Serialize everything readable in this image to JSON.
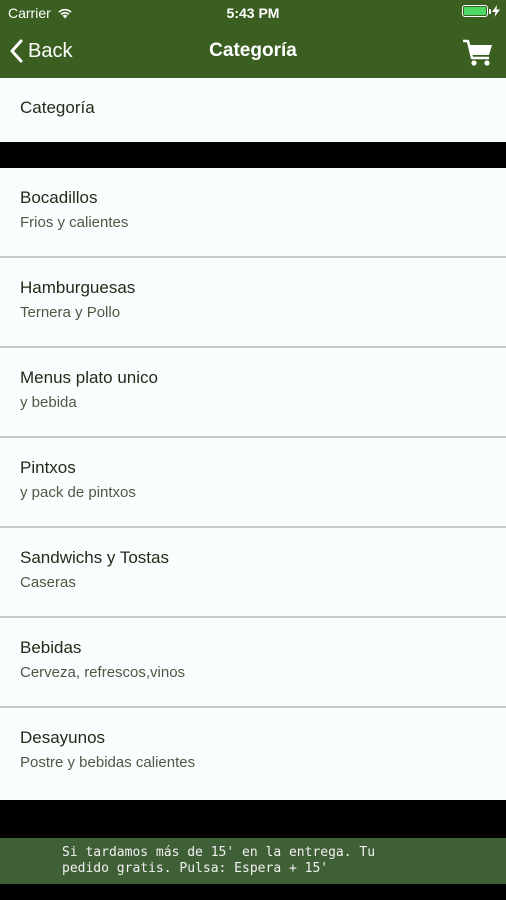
{
  "status_bar": {
    "carrier": "Carrier",
    "time": "5:43 PM",
    "battery_level": 1.0
  },
  "nav": {
    "back_label": "Back",
    "title": "Categoría",
    "cart_icon": "shopping-cart-icon"
  },
  "section_header": "Categoría",
  "categories": [
    {
      "title": "Bocadillos",
      "subtitle": "Frios y calientes"
    },
    {
      "title": "Hamburguesas",
      "subtitle": "Ternera y Pollo"
    },
    {
      "title": "Menus plato unico",
      "subtitle": "y bebida"
    },
    {
      "title": "Pintxos",
      "subtitle": "y pack de pintxos"
    },
    {
      "title": "Sandwichs y Tostas",
      "subtitle": "Caseras"
    },
    {
      "title": "Bebidas",
      "subtitle": "Cerveza, refrescos,vinos"
    },
    {
      "title": "Desayunos",
      "subtitle": "Postre y bebidas calientes"
    }
  ],
  "banner": {
    "line1": "Si tardamos más de 15' en la entrega. Tu",
    "line2": "pedido gratis. Pulsa: Espera + 15'"
  },
  "colors": {
    "bar": "#3b5f21",
    "banner": "#3f5f37",
    "row_bg": "#fafdfd"
  }
}
